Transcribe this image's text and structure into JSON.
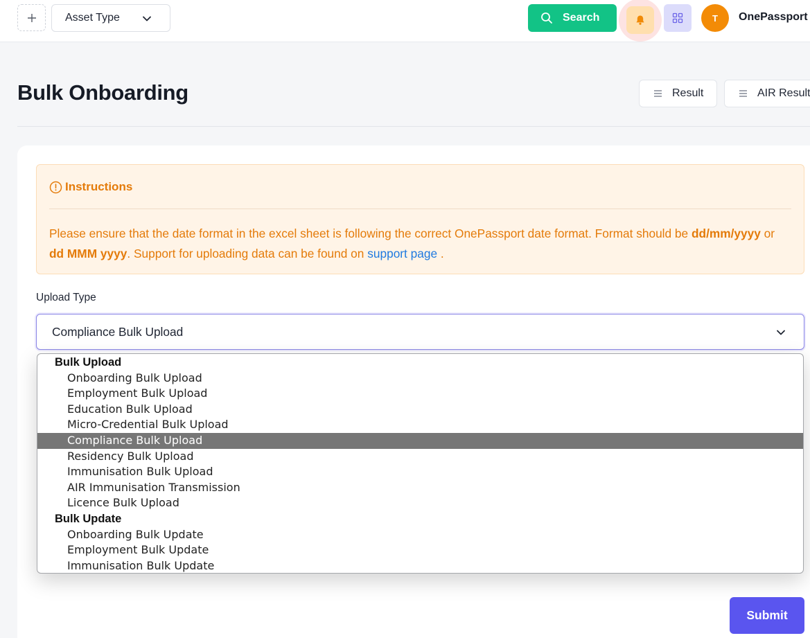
{
  "topbar": {
    "asset_select": {
      "value": "Asset Type"
    },
    "search_label": "Search",
    "avatar_initial": "T",
    "brand": "OnePassport"
  },
  "page": {
    "title": "Bulk Onboarding",
    "result_label": "Result",
    "air_result_label": "AIR Result"
  },
  "instructions": {
    "heading": "Instructions",
    "text_1": "Please ensure that the date format in the excel sheet is following the correct OnePassport date format. Format should be ",
    "format_1": "dd/mm/yyyy",
    "or": " or ",
    "format_2": "dd MMM yyyy",
    "text_2": ". Support for uploading data can be found on ",
    "link": "support page",
    "text_3": " ."
  },
  "upload": {
    "label": "Upload Type",
    "value": "Compliance Bulk Upload"
  },
  "dropdown": {
    "groups": [
      {
        "label": "Bulk Upload",
        "options": [
          "Onboarding Bulk Upload",
          "Employment Bulk Upload",
          "Education Bulk Upload",
          "Micro-Credential Bulk Upload",
          "Compliance Bulk Upload",
          "Residency Bulk Upload",
          "Immunisation Bulk Upload",
          "AIR Immunisation Transmission",
          "Licence Bulk Upload"
        ]
      },
      {
        "label": "Bulk Update",
        "options": [
          "Onboarding Bulk Update",
          "Employment Bulk Update",
          "Immunisation Bulk Update"
        ]
      }
    ]
  },
  "submit_label": "Submit",
  "colors": {
    "search_green": "#12c386",
    "submit_purple": "#5a55ef",
    "avatar_orange": "#f38b06",
    "instruction_orange": "#e47b0a",
    "link_blue": "#1f7ae0",
    "selected_option": "#767676"
  },
  "icons": [
    "plus-icon",
    "chevron-down-icon",
    "search-icon",
    "bell-icon",
    "grid-icon",
    "menu-icon",
    "alert-circle-icon"
  ]
}
